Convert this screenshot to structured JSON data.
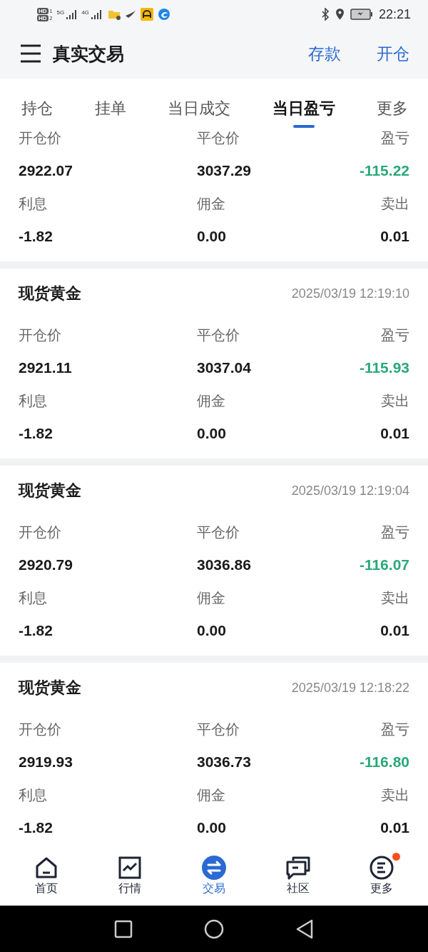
{
  "status_bar": {
    "sims": [
      {
        "label": "HD",
        "slot": "1",
        "network": "5G"
      },
      {
        "label": "HD",
        "slot": "2",
        "network": "4G"
      }
    ],
    "time": "22:21"
  },
  "header": {
    "title": "真实交易",
    "actions": [
      "存款",
      "开仓"
    ]
  },
  "tabs": [
    {
      "label": "持仓",
      "selected": false
    },
    {
      "label": "挂单",
      "selected": false
    },
    {
      "label": "当日成交",
      "selected": false
    },
    {
      "label": "当日盈亏",
      "selected": true
    },
    {
      "label": "更多",
      "selected": false
    }
  ],
  "trades": [
    {
      "fields": [
        {
          "label": "开仓价",
          "value": "2922.07",
          "kind": "price"
        },
        {
          "label": "平仓价",
          "value": "3037.29",
          "kind": "price"
        },
        {
          "label": "盈亏",
          "value": "-115.22",
          "kind": "loss"
        },
        {
          "label": "利息",
          "value": "-1.82",
          "kind": "price"
        },
        {
          "label": "佣金",
          "value": "0.00",
          "kind": "price"
        },
        {
          "label": "卖出",
          "value": "0.01",
          "kind": "price"
        }
      ]
    },
    {
      "title": "现货黄金",
      "time": "2025/03/19 12:19:10",
      "fields": [
        {
          "label": "开仓价",
          "value": "2921.11",
          "kind": "price"
        },
        {
          "label": "平仓价",
          "value": "3037.04",
          "kind": "price"
        },
        {
          "label": "盈亏",
          "value": "-115.93",
          "kind": "loss"
        },
        {
          "label": "利息",
          "value": "-1.82",
          "kind": "price"
        },
        {
          "label": "佣金",
          "value": "0.00",
          "kind": "price"
        },
        {
          "label": "卖出",
          "value": "0.01",
          "kind": "price"
        }
      ]
    },
    {
      "title": "现货黄金",
      "time": "2025/03/19 12:19:04",
      "fields": [
        {
          "label": "开仓价",
          "value": "2920.79",
          "kind": "price"
        },
        {
          "label": "平仓价",
          "value": "3036.86",
          "kind": "price"
        },
        {
          "label": "盈亏",
          "value": "-116.07",
          "kind": "loss"
        },
        {
          "label": "利息",
          "value": "-1.82",
          "kind": "price"
        },
        {
          "label": "佣金",
          "value": "0.00",
          "kind": "price"
        },
        {
          "label": "卖出",
          "value": "0.01",
          "kind": "price"
        }
      ]
    },
    {
      "title": "现货黄金",
      "time": "2025/03/19 12:18:22",
      "fields": [
        {
          "label": "开仓价",
          "value": "2919.93",
          "kind": "price"
        },
        {
          "label": "平仓价",
          "value": "3036.73",
          "kind": "price"
        },
        {
          "label": "盈亏",
          "value": "-116.80",
          "kind": "loss"
        },
        {
          "label": "利息",
          "value": "-1.82",
          "kind": "price"
        },
        {
          "label": "佣金",
          "value": "0.00",
          "kind": "price"
        },
        {
          "label": "卖出",
          "value": "0.01",
          "kind": "price"
        }
      ]
    }
  ],
  "bottom_nav": [
    {
      "label": "首页",
      "selected": false,
      "badge": false
    },
    {
      "label": "行情",
      "selected": false,
      "badge": false
    },
    {
      "label": "交易",
      "selected": true,
      "badge": false
    },
    {
      "label": "社区",
      "selected": false,
      "badge": false
    },
    {
      "label": "更多",
      "selected": false,
      "badge": true
    }
  ]
}
